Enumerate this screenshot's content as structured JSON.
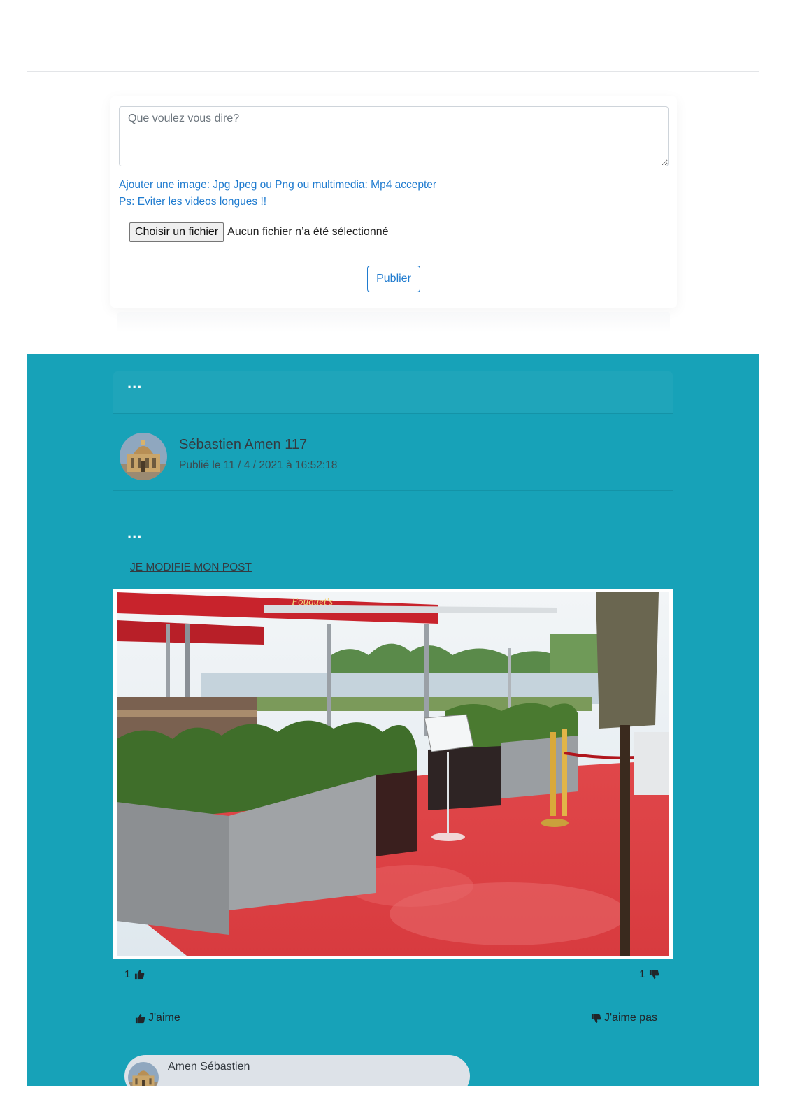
{
  "composer": {
    "placeholder": "Que voulez vous dire?",
    "help_line1": "Ajouter une image: Jpg Jpeg ou Png ou multimedia: Mp4 accepter",
    "help_line2": "Ps: Eviter les videos longues !!",
    "file_button": "Choisir un fichier",
    "file_status": "Aucun fichier n’a été sélectionné",
    "publish_label": "Publier"
  },
  "post": {
    "menu_dots": "...",
    "author": "Sébastien Amen 117",
    "date": "Publié le 11 / 4 / 2021 à 16:52:18",
    "content_dots": "...",
    "edit_link": "JE MODIFIE MON POST",
    "photo_sign": "Fouquet's",
    "likes": "1",
    "dislikes": "1",
    "like_label": "J'aime",
    "dislike_label": "J'aime pas",
    "comment_author": "Amen Sébastien"
  },
  "colors": {
    "feed_bg": "#17a2b8",
    "link_blue": "#1f7bcf",
    "comment_bg": "#dde2e8"
  },
  "icons": [
    "thumbs-up-icon",
    "thumbs-down-icon"
  ]
}
